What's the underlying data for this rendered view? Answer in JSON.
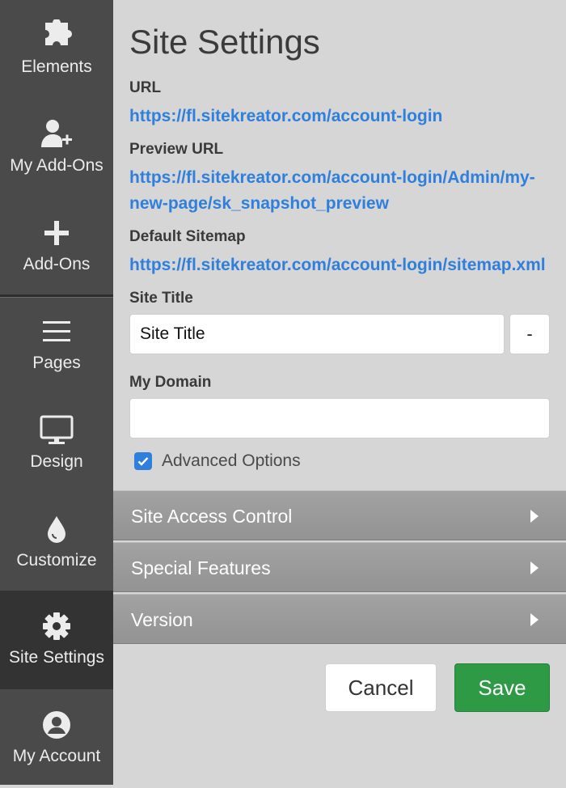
{
  "sidebar": {
    "items": [
      {
        "label": "Elements",
        "icon": "puzzle-icon"
      },
      {
        "label": "My Add-Ons",
        "icon": "user-plus-icon"
      },
      {
        "label": "Add-Ons",
        "icon": "plus-icon"
      },
      {
        "label": "Pages",
        "icon": "menu-icon"
      },
      {
        "label": "Design",
        "icon": "monitor-icon"
      },
      {
        "label": "Customize",
        "icon": "droplet-icon"
      },
      {
        "label": "Site Settings",
        "icon": "gear-icon",
        "active": true
      },
      {
        "label": "My Account",
        "icon": "account-icon"
      }
    ]
  },
  "main": {
    "title": "Site Settings",
    "url_label": "URL",
    "url": "https://fl.sitekreator.com/account-login",
    "preview_label": "Preview URL",
    "preview_url": "https://fl.sitekreator.com/account-login/Admin/my-new-page/sk_snapshot_preview",
    "sitemap_label": "Default Sitemap",
    "sitemap_url": "https://fl.sitekreator.com/account-login/sitemap.xml",
    "site_title_label": "Site Title",
    "site_title_value": "Site Title",
    "dash_button": "-",
    "domain_label": "My Domain",
    "domain_value": "",
    "advanced_label": "Advanced Options",
    "advanced_checked": true
  },
  "accordions": [
    {
      "label": "Site Access Control"
    },
    {
      "label": "Special Features"
    },
    {
      "label": "Version"
    }
  ],
  "actions": {
    "cancel": "Cancel",
    "save": "Save"
  },
  "colors": {
    "link": "#2f7fdc",
    "save": "#2e9a46",
    "sidebar": "#4a4a4a",
    "sidebar_active": "#333333",
    "background": "#d6d6d6"
  }
}
